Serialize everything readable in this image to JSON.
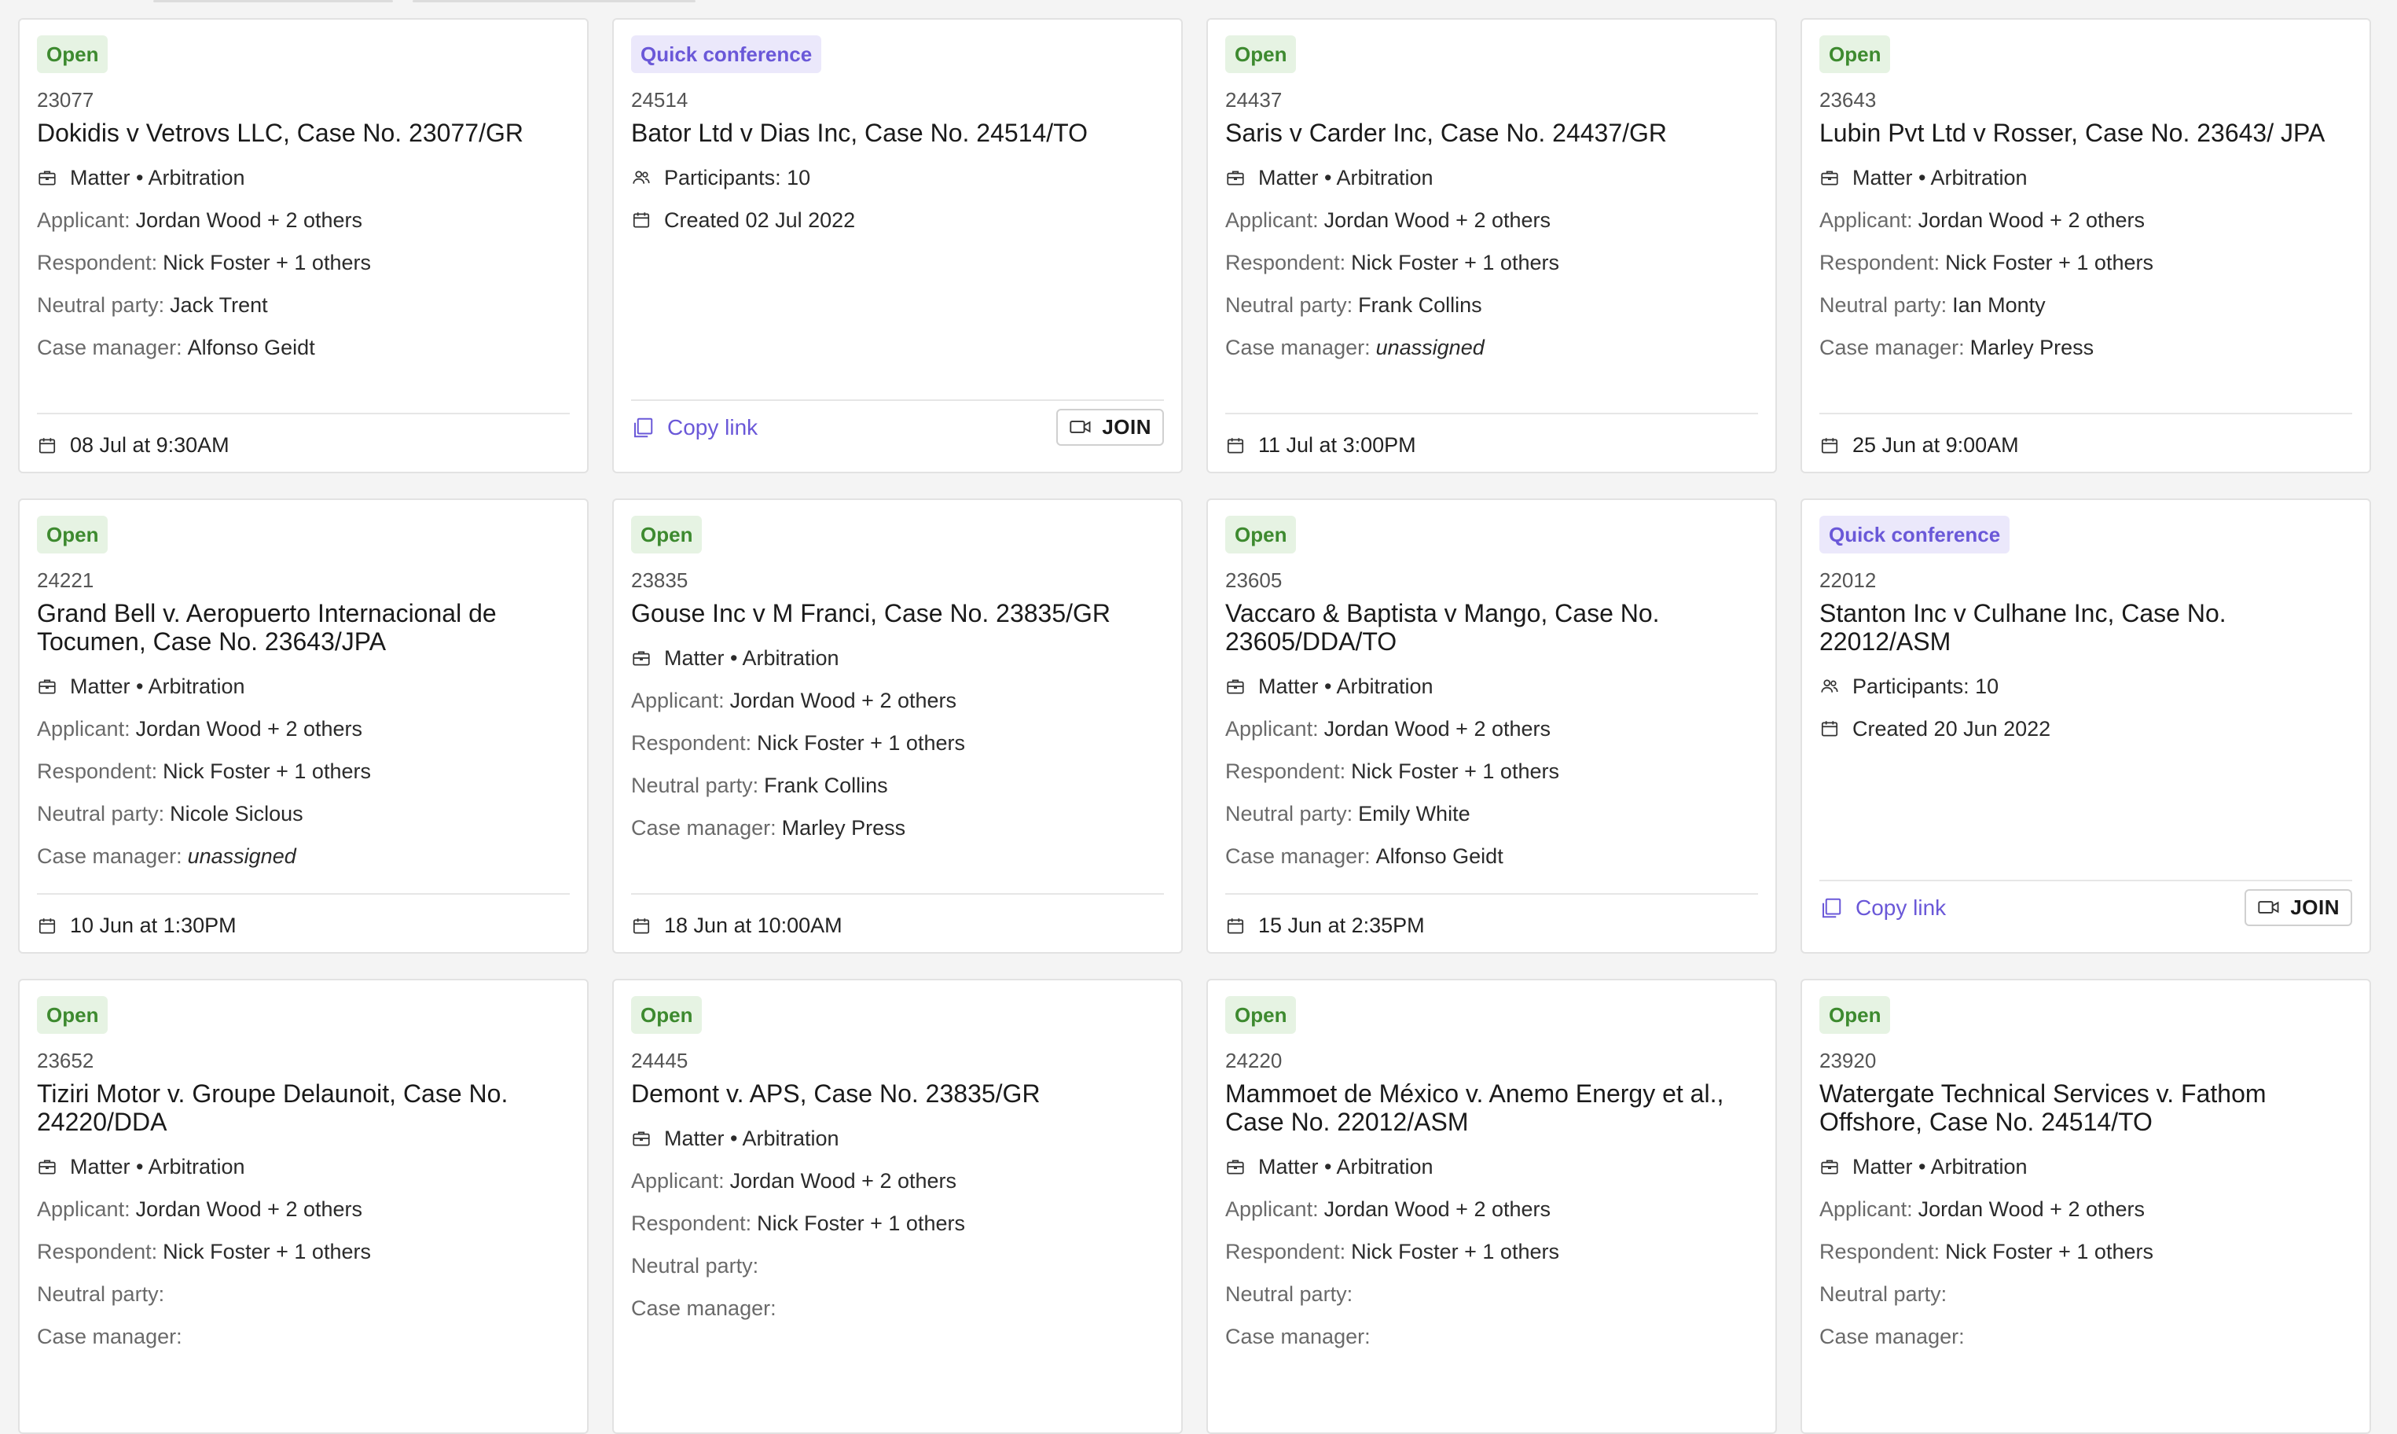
{
  "colors": {
    "open_bg": "#e6f3e3",
    "open_fg": "#3d8a2f",
    "quick_bg": "#ebe8fb",
    "quick_fg": "#6a58d8"
  },
  "labels": {
    "matter": "Matter • Arbitration",
    "applicant": "Applicant:",
    "respondent": "Respondent:",
    "neutral": "Neutral party:",
    "manager": "Case manager:",
    "copy_link": "Copy link",
    "join": "JOIN"
  },
  "cards": [
    {
      "type": "matter",
      "status": "Open",
      "id": "23077",
      "title": "Dokidis v Vetrovs LLC, Case No. 23077/GR",
      "applicant": "Jordan Wood + 2 others",
      "respondent": "Nick Foster + 1 others",
      "neutral": "Jack Trent",
      "manager": "Alfonso Geidt",
      "date": "08 Jul at 9:30AM"
    },
    {
      "type": "quick",
      "status": "Quick conference",
      "id": "24514",
      "title": "Bator Ltd v Dias Inc, Case No. 24514/TO",
      "participants": "Participants: 10",
      "created": "Created 02 Jul 2022"
    },
    {
      "type": "matter",
      "status": "Open",
      "id": "24437",
      "title": "Saris v Carder Inc, Case No. 24437/GR",
      "applicant": "Jordan Wood + 2 others",
      "respondent": "Nick Foster + 1 others",
      "neutral": "Frank Collins",
      "manager": "unassigned",
      "date": "11 Jul at 3:00PM"
    },
    {
      "type": "matter",
      "status": "Open",
      "id": "23643",
      "title": "Lubin Pvt Ltd v Rosser, Case No. 23643/ JPA",
      "applicant": "Jordan Wood + 2 others",
      "respondent": "Nick Foster + 1 others",
      "neutral": "Ian Monty",
      "manager": "Marley Press",
      "date": "25 Jun at 9:00AM"
    },
    {
      "type": "matter",
      "status": "Open",
      "id": "24221",
      "title": "Grand Bell v. Aeropuerto Internacional de Tocumen, Case No. 23643/JPA",
      "applicant": "Jordan Wood + 2 others",
      "respondent": "Nick Foster + 1 others",
      "neutral": "Nicole Siclous",
      "manager": "unassigned",
      "date": "10 Jun at 1:30PM"
    },
    {
      "type": "matter",
      "status": "Open",
      "id": "23835",
      "title": "Gouse Inc v M Franci, Case No. 23835/GR",
      "applicant": "Jordan Wood + 2 others",
      "respondent": "Nick Foster + 1 others",
      "neutral": "Frank Collins",
      "manager": "Marley Press",
      "date": "18 Jun at 10:00AM"
    },
    {
      "type": "matter",
      "status": "Open",
      "id": "23605",
      "title": "Vaccaro & Baptista v Mango, Case No. 23605/DDA/TO",
      "applicant": "Jordan Wood + 2 others",
      "respondent": "Nick Foster + 1 others",
      "neutral": "Emily White",
      "manager": "Alfonso Geidt",
      "date": "15 Jun at 2:35PM"
    },
    {
      "type": "quick",
      "status": "Quick conference",
      "id": "22012",
      "title": "Stanton Inc v Culhane Inc, Case No. 22012/ASM",
      "participants": "Participants: 10",
      "created": "Created 20 Jun 2022"
    },
    {
      "type": "matter",
      "status": "Open",
      "id": "23652",
      "title": "Tiziri Motor v. Groupe Delaunoit, Case No. 24220/DDA",
      "applicant": "Jordan Wood + 2 others",
      "respondent": "Nick Foster + 1 others",
      "neutral": "",
      "manager": "",
      "date": ""
    },
    {
      "type": "matter",
      "status": "Open",
      "id": "24445",
      "title": "Demont v. APS, Case No. 23835/GR",
      "applicant": "Jordan Wood + 2 others",
      "respondent": "Nick Foster + 1 others",
      "neutral": "",
      "manager": "",
      "date": ""
    },
    {
      "type": "matter",
      "status": "Open",
      "id": "24220",
      "title": "Mammoet de México v. Anemo Energy et al., Case No. 22012/ASM",
      "applicant": "Jordan Wood + 2 others",
      "respondent": "Nick Foster + 1 others",
      "neutral": "",
      "manager": "",
      "date": ""
    },
    {
      "type": "matter",
      "status": "Open",
      "id": "23920",
      "title": "Watergate Technical Services v. Fathom Offshore, Case No. 24514/TO",
      "applicant": "Jordan Wood + 2 others",
      "respondent": "Nick Foster + 1 others",
      "neutral": "",
      "manager": "",
      "date": ""
    }
  ]
}
